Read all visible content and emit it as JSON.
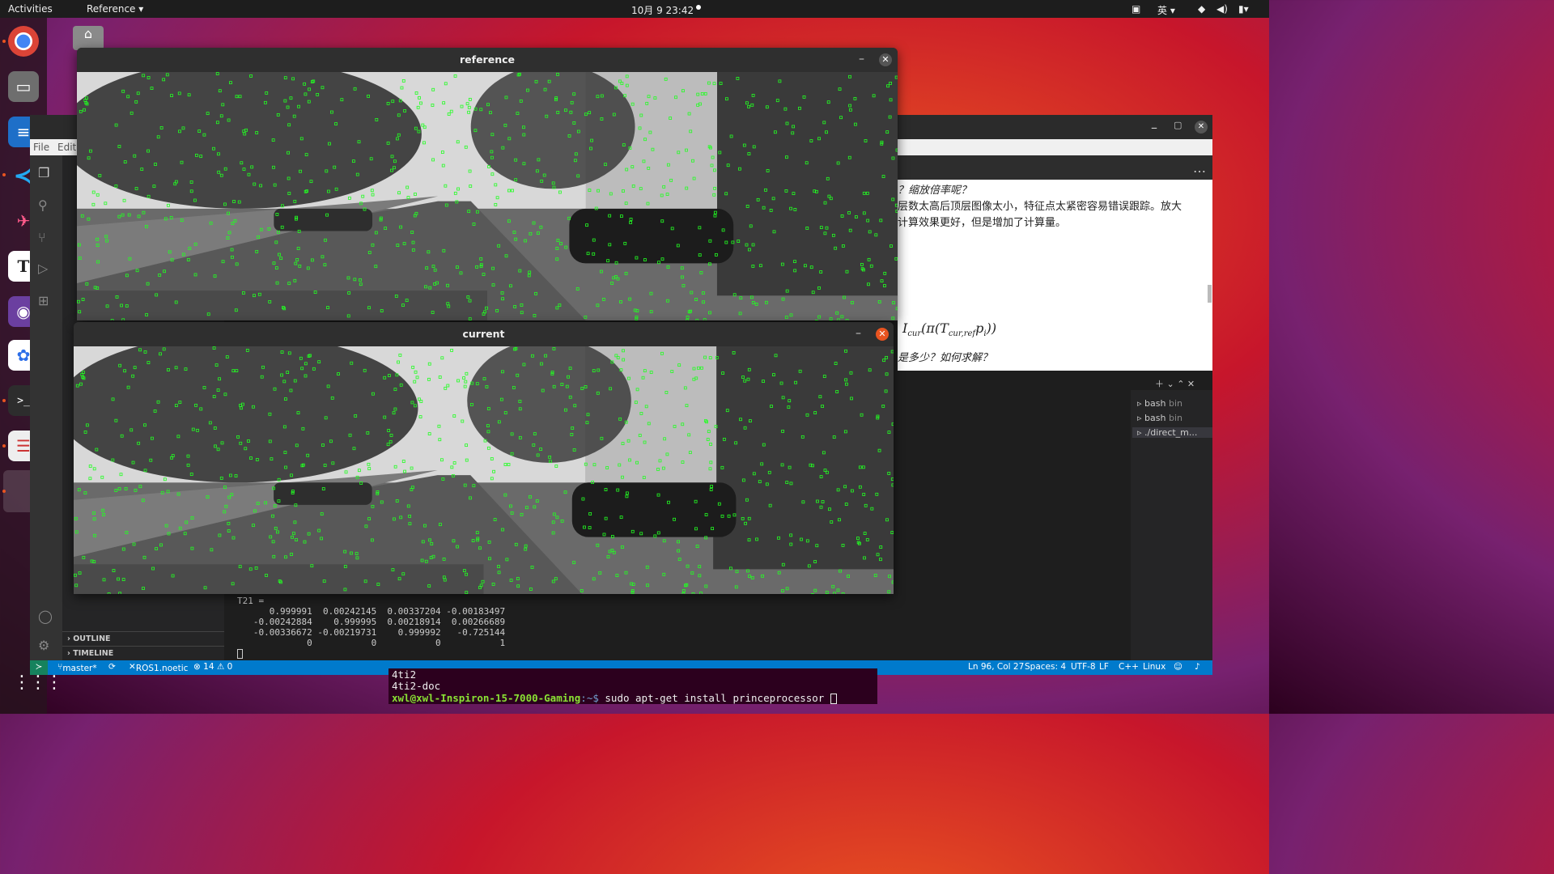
{
  "topbar": {
    "activities": "Activities",
    "app_menu": "Reference ▾",
    "clock": "10月 9  23:42",
    "input_method": "英 ▾"
  },
  "dock": {
    "icons": [
      "chrome-icon",
      "files-icon",
      "writer-icon",
      "vscode-icon",
      "kite-icon",
      "typora-icon",
      "video-icon",
      "baidu-icon",
      "terminal-icon",
      "reader-icon"
    ],
    "badge": "1"
  },
  "windows": {
    "reference": {
      "title": "reference",
      "minimize": "–",
      "close": "✕"
    },
    "current": {
      "title": "current",
      "minimize": "–",
      "close": "✕"
    }
  },
  "vscode": {
    "menu": [
      "File",
      "Edit"
    ],
    "editor_lines": [
      "？缩放倍率呢？",
      "层数太高后顶层图像太小，特征点太紧密容易错误跟踪。放大",
      "计算效果更好，但是增加了计算量。",
      "是多少？如何求解？"
    ],
    "formula": "I",
    "formula_sub": "cur",
    "formula_rest": "(π(T",
    "formula_sub2": "cur,ref",
    "formula_end": "p",
    "formula_sub3": "i",
    "formula_close": "))",
    "term_tabs": [
      "bash",
      "bash",
      "./direct_m..."
    ],
    "term_tab_suffix": [
      "bin",
      "bin",
      ""
    ],
    "sidebar": {
      "outline": "OUTLINE",
      "timeline": "TIMELINE"
    },
    "terminal": [
      "T21 = ",
      "      0.999991  0.00242145  0.00337204 -0.00183497",
      "   -0.00242884    0.999995  0.00218914  0.00266689",
      "   -0.00336672 -0.00219731    0.999992   -0.725144",
      "             0           0           0           1"
    ],
    "status": {
      "branch": "master*",
      "ros": "ROS1.noetic",
      "problems": "⊗ 14 ⚠ 0",
      "position": "Ln 96, Col 27",
      "spaces": "Spaces: 4",
      "encoding": "UTF-8",
      "eol": "LF",
      "lang": "C++",
      "os": "Linux"
    }
  },
  "bottom_terminal": {
    "lines": [
      "4ti2",
      "4ti2-doc"
    ],
    "prompt_user": "xwl@xwl-Inspiron-15-7000-Gaming",
    "prompt_path": ":~$ ",
    "command": "sudo apt-get install princeprocessor"
  },
  "colors": {
    "keypoint": "#22ff22",
    "ubuntu_orange": "#e95420",
    "status_blue": "#007acc"
  }
}
